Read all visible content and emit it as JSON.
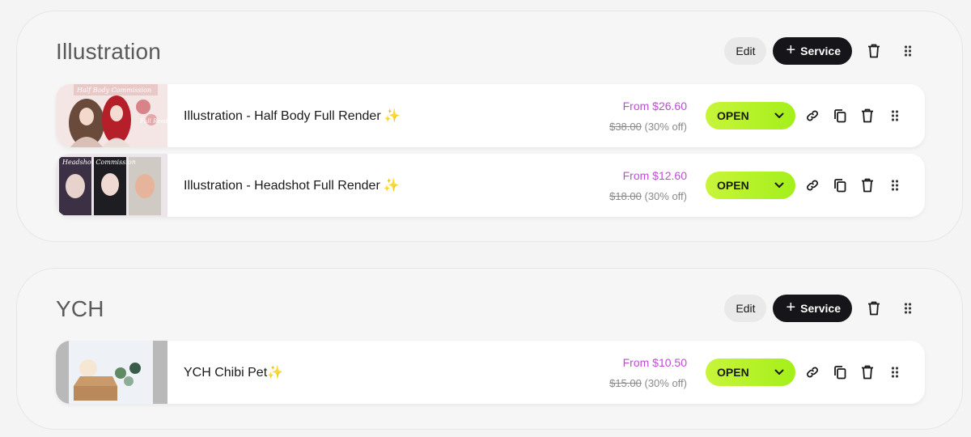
{
  "sections": [
    {
      "title": "Illustration",
      "edit_label": "Edit",
      "service_label": "Service",
      "services": [
        {
          "title": "Illustration - Half Body Full Render",
          "sparkle": "✨",
          "price_from": "From $26.60",
          "price_old": "$38.00",
          "discount": "(30% off)",
          "status": "OPEN",
          "thumb_text": "Half Body Commission",
          "thumb_text2": "Full Render"
        },
        {
          "title": "Illustration - Headshot Full Render",
          "sparkle": "✨",
          "price_from": "From $12.60",
          "price_old": "$18.00",
          "discount": "(30% off)",
          "status": "OPEN",
          "thumb_text": "Headshot Commission"
        }
      ]
    },
    {
      "title": "YCH",
      "edit_label": "Edit",
      "service_label": "Service",
      "services": [
        {
          "title": "YCH Chibi Pet",
          "sparkle": "✨",
          "price_from": "From $10.50",
          "price_old": "$15.00",
          "discount": "(30% off)",
          "status": "OPEN"
        }
      ]
    }
  ],
  "colors": {
    "accent_status": "#b6f22a",
    "price": "#c04ad8",
    "dark_button": "#16161a"
  },
  "icons": [
    "plus-icon",
    "trash-icon",
    "drag-handle-icon",
    "link-icon",
    "copy-icon",
    "chevron-down-icon"
  ]
}
